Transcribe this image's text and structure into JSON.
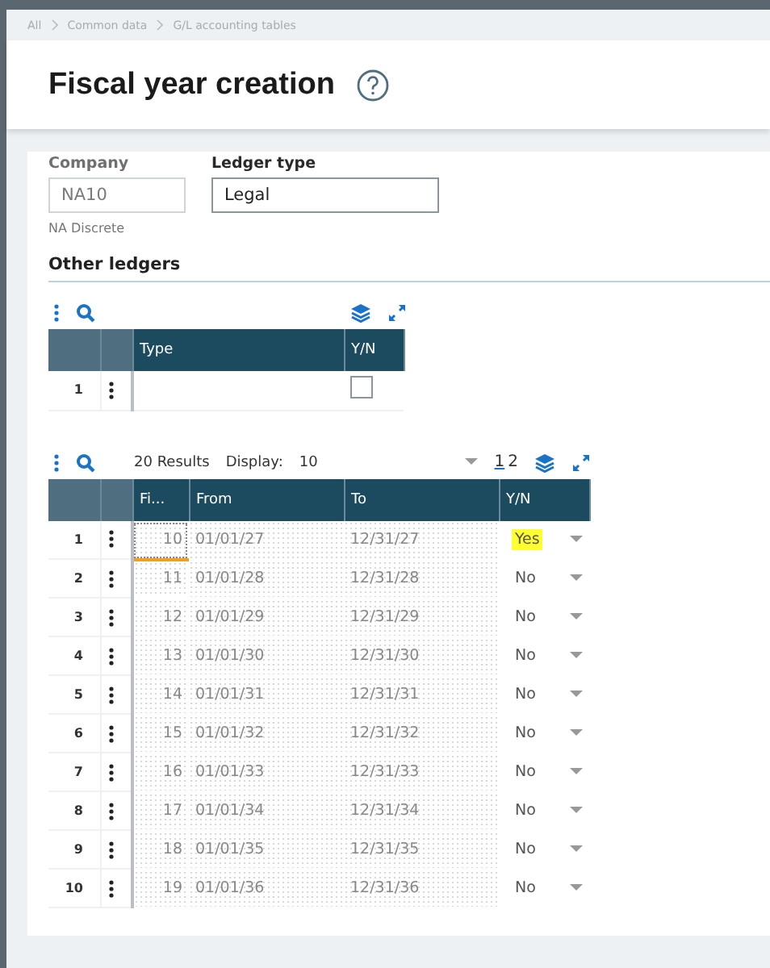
{
  "breadcrumb": [
    "All",
    "Common data",
    "G/L accounting tables"
  ],
  "title": "Fiscal year creation",
  "fields": [
    {
      "label": "Company",
      "value": "NA10",
      "disabled": true,
      "hint": "NA Discrete"
    },
    {
      "label": "Ledger type",
      "value": "Legal",
      "disabled": false
    }
  ],
  "other_ledgers": {
    "title": "Other ledgers",
    "columns": [
      "Type",
      "Y/N"
    ],
    "rows": [
      {
        "number": "1",
        "type": "",
        "checked": false
      }
    ]
  },
  "years": {
    "results": "20 Results",
    "display_label": "Display:",
    "display_value": "10",
    "pages": [
      {
        "label": "1",
        "selected": true
      },
      {
        "label": "2",
        "selected": false
      }
    ],
    "columns": [
      "Fi...",
      "From",
      "To",
      "Y/N"
    ],
    "rows": [
      {
        "number": "1",
        "fiscal": "10",
        "from": "01/01/27",
        "to": "12/31/27",
        "yn": "Yes",
        "highlighted": true,
        "focused": true
      },
      {
        "number": "2",
        "fiscal": "11",
        "from": "01/01/28",
        "to": "12/31/28",
        "yn": "No",
        "highlighted": false,
        "focused": false
      },
      {
        "number": "3",
        "fiscal": "12",
        "from": "01/01/29",
        "to": "12/31/29",
        "yn": "No",
        "highlighted": false,
        "focused": false
      },
      {
        "number": "4",
        "fiscal": "13",
        "from": "01/01/30",
        "to": "12/31/30",
        "yn": "No",
        "highlighted": false,
        "focused": false
      },
      {
        "number": "5",
        "fiscal": "14",
        "from": "01/01/31",
        "to": "12/31/31",
        "yn": "No",
        "highlighted": false,
        "focused": false
      },
      {
        "number": "6",
        "fiscal": "15",
        "from": "01/01/32",
        "to": "12/31/32",
        "yn": "No",
        "highlighted": false,
        "focused": false
      },
      {
        "number": "7",
        "fiscal": "16",
        "from": "01/01/33",
        "to": "12/31/33",
        "yn": "No",
        "highlighted": false,
        "focused": false
      },
      {
        "number": "8",
        "fiscal": "17",
        "from": "01/01/34",
        "to": "12/31/34",
        "yn": "No",
        "highlighted": false,
        "focused": false
      },
      {
        "number": "9",
        "fiscal": "18",
        "from": "01/01/35",
        "to": "12/31/35",
        "yn": "No",
        "highlighted": false,
        "focused": false
      },
      {
        "number": "10",
        "fiscal": "19",
        "from": "01/01/36",
        "to": "12/31/36",
        "yn": "No",
        "highlighted": false,
        "focused": false
      }
    ]
  }
}
